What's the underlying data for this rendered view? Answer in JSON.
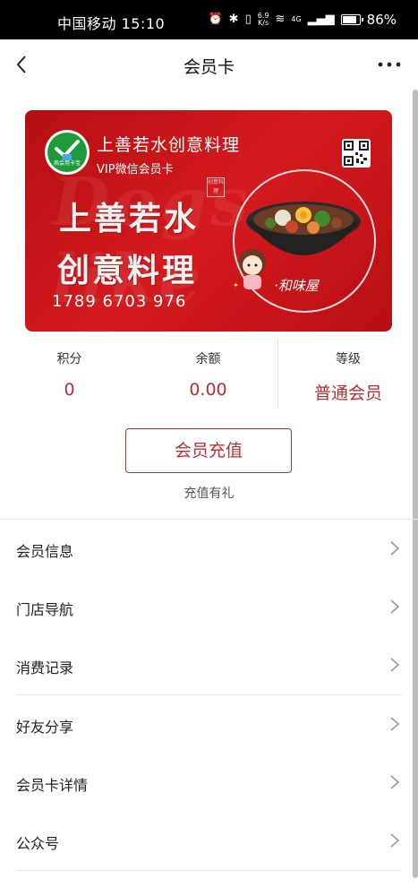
{
  "status_bar": {
    "carrier_time": "中国移动 15:10",
    "net_speed_value": "6.9",
    "net_speed_unit": "K/s",
    "signal_label": "4G",
    "battery_text": "86%",
    "battery_level": 0.86
  },
  "nav": {
    "title": "会员卡",
    "back_icon": "chevron-left-icon",
    "more_icon": "more-dots-icon"
  },
  "card": {
    "merchant_name": "上善若水创意料理",
    "card_type": "VIP微信会员卡",
    "logo_text": "商会用卡宝",
    "headline_line1": "上善若水",
    "headline_line2": "创意料理",
    "card_number": "1789 6703 976",
    "stamp_text": "创意料理",
    "badge_text": "·和味屋",
    "watermark": "Dogs like",
    "qr_icon": "qr-code-icon",
    "accent_color": "#c8161b"
  },
  "stats": {
    "points_label": "积分",
    "points_value": "0",
    "balance_label": "余额",
    "balance_value": "0.00",
    "level_label": "等级",
    "level_value": "普通会员",
    "value_color": "#b7302f"
  },
  "recharge": {
    "button_label": "会员充值",
    "tip": "充值有礼"
  },
  "menu": [
    {
      "label": "会员信息",
      "icon": "chevron-right-icon"
    },
    {
      "label": "门店导航",
      "icon": "chevron-right-icon"
    },
    {
      "label": "消费记录",
      "icon": "chevron-right-icon"
    },
    {
      "label": "好友分享",
      "icon": "chevron-right-icon"
    },
    {
      "label": "会员卡详情",
      "icon": "chevron-right-icon"
    },
    {
      "label": "公众号",
      "icon": "chevron-right-icon"
    }
  ]
}
